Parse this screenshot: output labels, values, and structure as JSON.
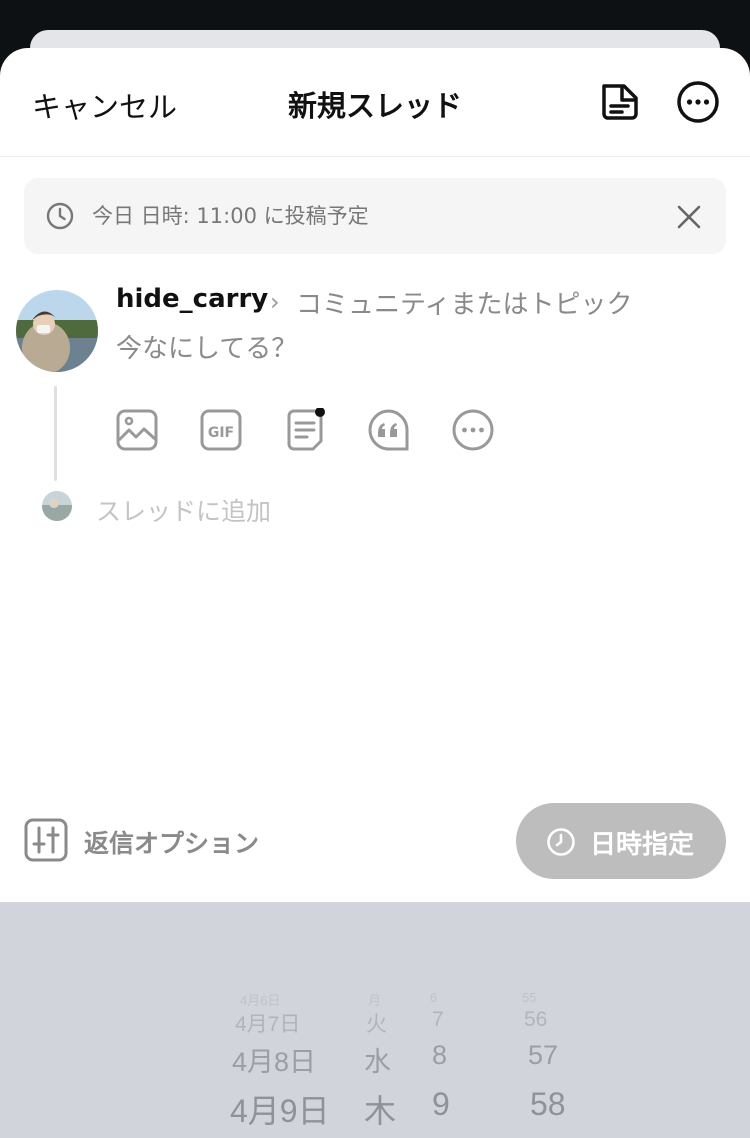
{
  "header": {
    "cancel_label": "キャンセル",
    "title": "新規スレッド"
  },
  "icons": {
    "drafts": "drafts-icon",
    "more": "more-options-icon",
    "clock": "clock-icon",
    "close": "close-icon",
    "image": "image-icon",
    "gif": "gif-icon",
    "poll": "document-icon",
    "quote": "quote-icon",
    "more_tools": "more-icon",
    "reply_options": "sliders-icon"
  },
  "schedule_banner": {
    "text": "今日 日時: 11:00 に投稿予定"
  },
  "composer": {
    "username": "hide_carry",
    "community_placeholder": "コミュニティまたはトピック",
    "text_placeholder": "今なにしてる？",
    "add_thread_label": "スレッドに追加",
    "gif_label": "GIF"
  },
  "footer": {
    "reply_options_label": "返信オプション",
    "schedule_label": "日時指定"
  },
  "picker": {
    "rows": [
      {
        "date": "4月6日",
        "weekday": "月",
        "hour": "6",
        "minute": "55"
      },
      {
        "date": "4月7日",
        "weekday": "火",
        "hour": "7",
        "minute": "56"
      },
      {
        "date": "4月8日",
        "weekday": "水",
        "hour": "8",
        "minute": "57"
      },
      {
        "date": "4月9日",
        "weekday": "木",
        "hour": "9",
        "minute": "58"
      }
    ]
  },
  "colors": {
    "accent_disabled": "#bdbdbd",
    "picker_bg": "#d1d4db",
    "dot": "#111111"
  }
}
